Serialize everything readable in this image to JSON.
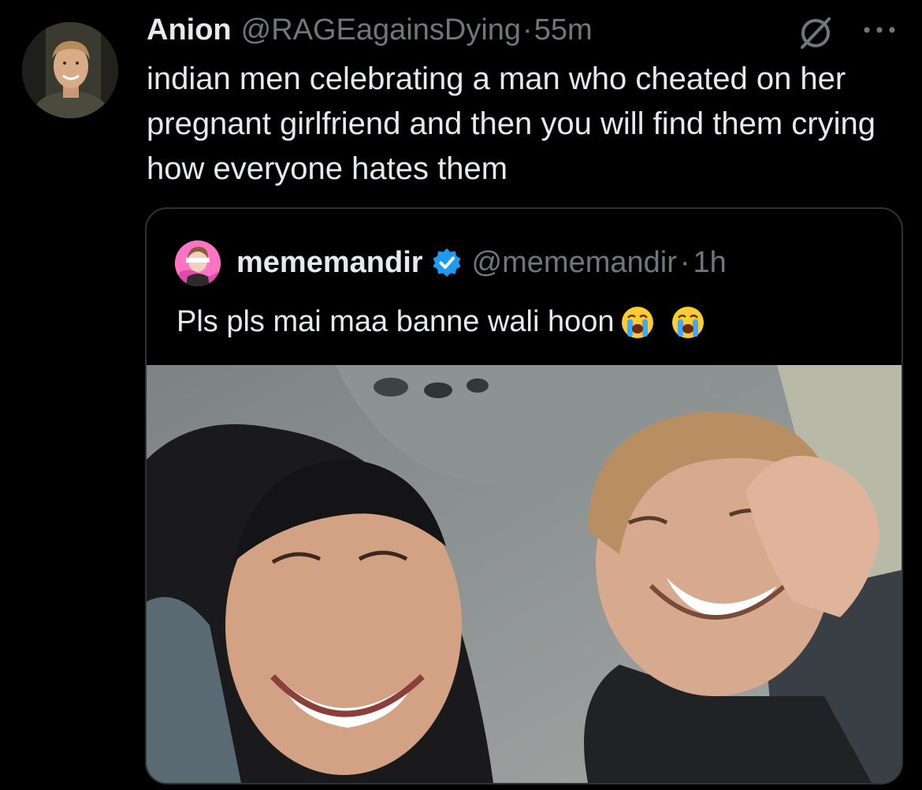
{
  "tweet": {
    "display_name": "Anion",
    "handle": "@RAGEagainsDying",
    "separator": "·",
    "time": "55m",
    "text": "indian men celebrating a man who cheated on her pregnant girlfriend and then you will find them crying how everyone hates them",
    "icons": {
      "avatar": "profile-photo",
      "mute": "muted-icon",
      "more": "more-options-icon"
    }
  },
  "quoted_tweet": {
    "display_name": "mememandir",
    "handle": "@mememandir",
    "separator": "·",
    "time": "1h",
    "text": "Pls pls mai maa banne wali hoon",
    "emojis": [
      "loudly-crying-face",
      "loudly-crying-face"
    ],
    "verified": true,
    "colors": {
      "verified_badge": "#1d9bf0"
    }
  },
  "colors": {
    "background": "#000000",
    "primary_text": "#e7e9ea",
    "secondary_text": "#71767b",
    "border": "#2f3336"
  }
}
